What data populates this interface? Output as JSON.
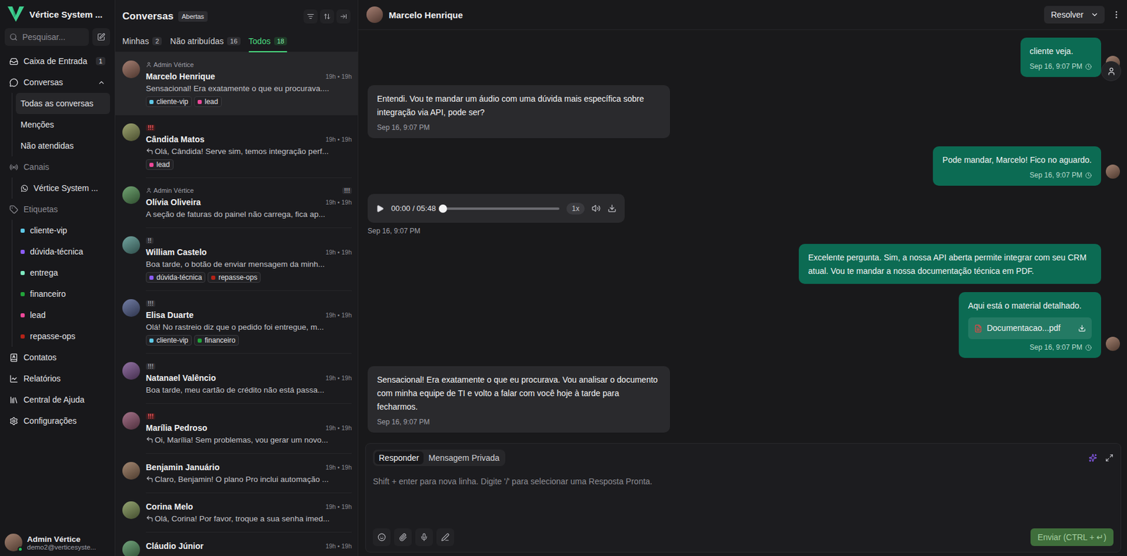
{
  "sidebar": {
    "brand": {
      "title": "Vértice System ..."
    },
    "search": {
      "placeholder": "Pesquisar..."
    },
    "inbox": {
      "label": "Caixa de Entrada",
      "badge": "1",
      "selected": false
    },
    "conversations": {
      "label": "Conversas",
      "expanded": true,
      "selected": false,
      "children": [
        {
          "label": "Todas as conversas",
          "selected": true
        },
        {
          "label": "Menções",
          "selected": false
        },
        {
          "label": "Não atendidas",
          "selected": false
        }
      ]
    },
    "channels": {
      "label": "Canais",
      "children": [
        {
          "label": "Vértice System ...",
          "selected": false
        }
      ]
    },
    "labels": {
      "label": "Etiquetas",
      "children": [
        {
          "label": "cliente-vip",
          "color": "#5ec8e6"
        },
        {
          "label": "dúvida-técnica",
          "color": "#8b5cf6"
        },
        {
          "label": "entrega",
          "color": "#7ee8c0"
        },
        {
          "label": "financeiro",
          "color": "#22a33a"
        },
        {
          "label": "lead",
          "color": "#ec4899"
        },
        {
          "label": "repasse-ops",
          "color": "#b42318"
        }
      ]
    },
    "contacts": {
      "label": "Contatos",
      "selected": false
    },
    "reports": {
      "label": "Relatórios",
      "selected": false
    },
    "help": {
      "label": "Central de Ajuda",
      "selected": false
    },
    "settings": {
      "label": "Configurações",
      "selected": false
    },
    "user": {
      "name": "Admin Vértice",
      "email": "demo2@verticesyste...",
      "online": true
    }
  },
  "conversation_list": {
    "title": "Conversas",
    "status": "Abertas",
    "tabs": [
      {
        "label": "Minhas",
        "count": "2",
        "selected": false
      },
      {
        "label": "Não atribuídas",
        "count": "16",
        "selected": false
      },
      {
        "label": "Todos",
        "count": "18",
        "selected": true
      }
    ],
    "items": [
      {
        "name": "Marcelo Henrique",
        "assignee": "Admin Vértice",
        "time": "19h • 19h",
        "reply": false,
        "preview": "Sensacional! Era exatamente o que eu procurava....",
        "tags": [
          {
            "label": "cliente-vip",
            "color": "#5ec8e6"
          },
          {
            "label": "lead",
            "color": "#ec4899"
          }
        ],
        "selected": true
      },
      {
        "name": "Cândida Matos",
        "priority": {
          "text": "!!!",
          "urgent": true
        },
        "time": "19h • 19h",
        "reply": true,
        "preview": "Olá, Cândida! Serve sim, temos integração perf...",
        "tags": [
          {
            "label": "lead",
            "color": "#ec4899"
          }
        ],
        "selected": false
      },
      {
        "name": "Olívia Oliveira",
        "assignee": "Admin Vértice",
        "priority": {
          "text": "!!!",
          "urgent": false
        },
        "time": "19h • 19h",
        "reply": false,
        "preview": "A seção de faturas do painel não carrega, fica ap...",
        "tags": [],
        "selected": false
      },
      {
        "name": "William Castelo",
        "priority": {
          "text": "!!",
          "urgent": false
        },
        "time": "19h • 19h",
        "reply": false,
        "preview": "Boa tarde, o botão de enviar mensagem da minh...",
        "tags": [
          {
            "label": "dúvida-técnica",
            "color": "#8b5cf6"
          },
          {
            "label": "repasse-ops",
            "color": "#b42318"
          }
        ],
        "selected": false
      },
      {
        "name": "Elisa Duarte",
        "priority": {
          "text": "!!!",
          "urgent": false
        },
        "time": "19h • 19h",
        "reply": false,
        "preview": "Olá! No rastreio diz que o pedido foi entregue, m...",
        "tags": [
          {
            "label": "cliente-vip",
            "color": "#5ec8e6"
          },
          {
            "label": "financeiro",
            "color": "#22a33a"
          }
        ],
        "selected": false
      },
      {
        "name": "Natanael Valêncio",
        "priority": {
          "text": "!!!",
          "urgent": false
        },
        "time": "19h • 19h",
        "reply": false,
        "preview": "Boa tarde, meu cartão de crédito não está passa...",
        "tags": [],
        "selected": false
      },
      {
        "name": "Marília Pedroso",
        "priority": {
          "text": "!!!",
          "urgent": true
        },
        "time": "19h • 19h",
        "reply": true,
        "preview": "Oi, Marília! Sem problemas, vou gerar um novo...",
        "tags": [],
        "selected": false
      },
      {
        "name": "Benjamin Januário",
        "time": "19h • 19h",
        "reply": true,
        "preview": "Claro, Benjamin! O plano Pro inclui automação ...",
        "tags": [],
        "selected": false
      },
      {
        "name": "Corina Melo",
        "time": "19h • 19h",
        "reply": true,
        "preview": "Olá, Corina! Por favor, troque a sua senha imed...",
        "tags": [],
        "selected": false
      },
      {
        "name": "Cláudio Júnior",
        "time": "19h • 19h",
        "reply": false,
        "tags": [],
        "selected": false
      }
    ]
  },
  "chat": {
    "contact": {
      "name": "Marcelo Henrique"
    },
    "resolve": {
      "label": "Resolver"
    },
    "messages": [
      {
        "kind": "text",
        "direction": "outgoing",
        "text": "cliente veja.",
        "time": "Sep 16, 9:07 PM"
      },
      {
        "kind": "text",
        "direction": "incoming",
        "text": "Entendi. Vou te mandar um áudio com uma dúvida mais específica sobre integração via API, pode ser?",
        "time": "Sep 16, 9:07 PM"
      },
      {
        "kind": "text",
        "direction": "outgoing",
        "text": "Pode mandar, Marcelo! Fico no aguardo.",
        "time": "Sep 16, 9:07 PM"
      },
      {
        "kind": "audio",
        "direction": "incoming",
        "position": "00:00 / 05:48",
        "speed": "1x",
        "level": 0,
        "time": "Sep 16, 9:07 PM"
      },
      {
        "kind": "text",
        "direction": "outgoing",
        "text": "Excelente pergunta. Sim, a nossa API aberta permite integrar com seu CRM atual. Vou te mandar a nossa documentação técnica em PDF."
      },
      {
        "kind": "file",
        "direction": "outgoing",
        "text": "Aqui está o material detalhado.",
        "file": "Documentacao...pdf",
        "time": "Sep 16, 9:07 PM"
      },
      {
        "kind": "text",
        "direction": "incoming",
        "text": "Sensacional! Era exatamente o que eu procurava. Vou analisar o documento com minha equipe de TI e volto a falar com você hoje à tarde para fecharmos.",
        "time": "Sep 16, 9:07 PM"
      }
    ],
    "composer": {
      "tabs": [
        {
          "label": "Responder",
          "selected": true
        },
        {
          "label": "Mensagem Privada",
          "selected": false
        }
      ],
      "placeholder": "Shift + enter para nova linha. Digite '/' para selecionar uma Resposta Pronta.",
      "send": {
        "label": "Enviar (CTRL + ↵)",
        "disabled": true
      }
    }
  }
}
